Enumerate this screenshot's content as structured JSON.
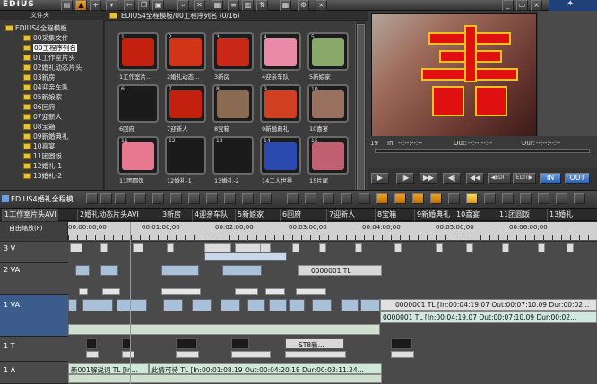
{
  "app": {
    "title": "EDIUS"
  },
  "bin": {
    "tree_header": "文件夹",
    "path": "EDIUS4全程模板/00工程序列名 (0/16)",
    "root": "EDIUS4全程模板",
    "folders": [
      "00采集文件",
      "00工程序列名",
      "01工作室片头",
      "02婚礼动态片头",
      "03新房",
      "04迎亲车队",
      "05新娘家",
      "06回府",
      "07迎新人",
      "08宝箱",
      "09新婚典礼",
      "10喜宴",
      "11团圆饭",
      "12婚礼-1",
      "13婚礼-2"
    ],
    "selected_index": 1,
    "thumbs": [
      {
        "num": "1",
        "label": "1工作室片...",
        "bg": "#c42010"
      },
      {
        "num": "2",
        "label": "2婚礼动态...",
        "bg": "#d23418"
      },
      {
        "num": "3",
        "label": "3新房",
        "bg": "#c82818"
      },
      {
        "num": "4",
        "label": "4迎亲车队",
        "bg": "#e88aa8"
      },
      {
        "num": "5",
        "label": "5新娘家",
        "bg": "#8aa86a"
      },
      {
        "num": "6",
        "label": "6回府",
        "bg": "#1a1a1a"
      },
      {
        "num": "7",
        "label": "7迎新人",
        "bg": "#c42010"
      },
      {
        "num": "8",
        "label": "8宝箱",
        "bg": "#8a6a50"
      },
      {
        "num": "9",
        "label": "9新婚典礼",
        "bg": "#d04020"
      },
      {
        "num": "10",
        "label": "10喜宴",
        "bg": "#9a7060"
      },
      {
        "num": "11",
        "label": "11团圆饭",
        "bg": "#e87890"
      },
      {
        "num": "12",
        "label": "12婚礼-1",
        "bg": "#1a1a1a"
      },
      {
        "num": "13",
        "label": "13婚礼-2",
        "bg": "#1a1a1a"
      },
      {
        "num": "14",
        "label": "14二人世界",
        "bg": "#2a4ab0"
      },
      {
        "num": "15",
        "label": "15片尾",
        "bg": "#c06070"
      }
    ]
  },
  "player": {
    "in_label": "In:",
    "in_value": "--:--:--:--",
    "out_label": "Out:",
    "out_value": "--:--:--:--",
    "dur_label": "Dur:",
    "dur_value": "--:--:--:--",
    "timecode_left": "19",
    "buttons": [
      "▶",
      "|▶",
      "▶▶",
      "◀|",
      "◀◀"
    ],
    "edit_btns": [
      "◀EDIT",
      "EDIT▶"
    ],
    "in_btn": "IN",
    "out_btn": "OUT"
  },
  "timeline": {
    "sequence_tab": "EDIUS4婚礼全程模",
    "scale_label": "自由缩放(F)",
    "tabs": [
      "1工作室片头AVI",
      "2婚礼动态片头AVI",
      "3新房",
      "4迎亲车队",
      "5新娘家",
      "6回府",
      "7迎新人",
      "8宝箱",
      "9新婚典礼",
      "10喜宴",
      "11团圆饭",
      "13婚礼"
    ],
    "ruler": [
      "00:00:00;00",
      "00:01:00;00",
      "00:02:00;00",
      "00:03:00;00",
      "00:04:00;00",
      "00:05:00;00",
      "00:06:00;00"
    ],
    "tracks": [
      {
        "name": "3 V"
      },
      {
        "name": "2 VA"
      },
      {
        "name": "1 VA"
      },
      {
        "name": "1 T"
      },
      {
        "name": "1 A"
      }
    ],
    "clip_v2": "0000001  TL",
    "clip_v1_top": "0000001  TL [In:00:04:19.07 Out:00:07:10.09 Dur:00:02...",
    "clip_v1_bot": "0000001  TL [In:00:04:19.07 Out:00:07:10.09 Dur:00:02...",
    "clip_t1": "ST8新...",
    "clip_a1_left": "新001解说词  TL [In...",
    "clip_a1_mid": "此情可待  TL [In:00:01:08.19 Out:00:04:20.18 Dur:00:03:11.24..."
  }
}
